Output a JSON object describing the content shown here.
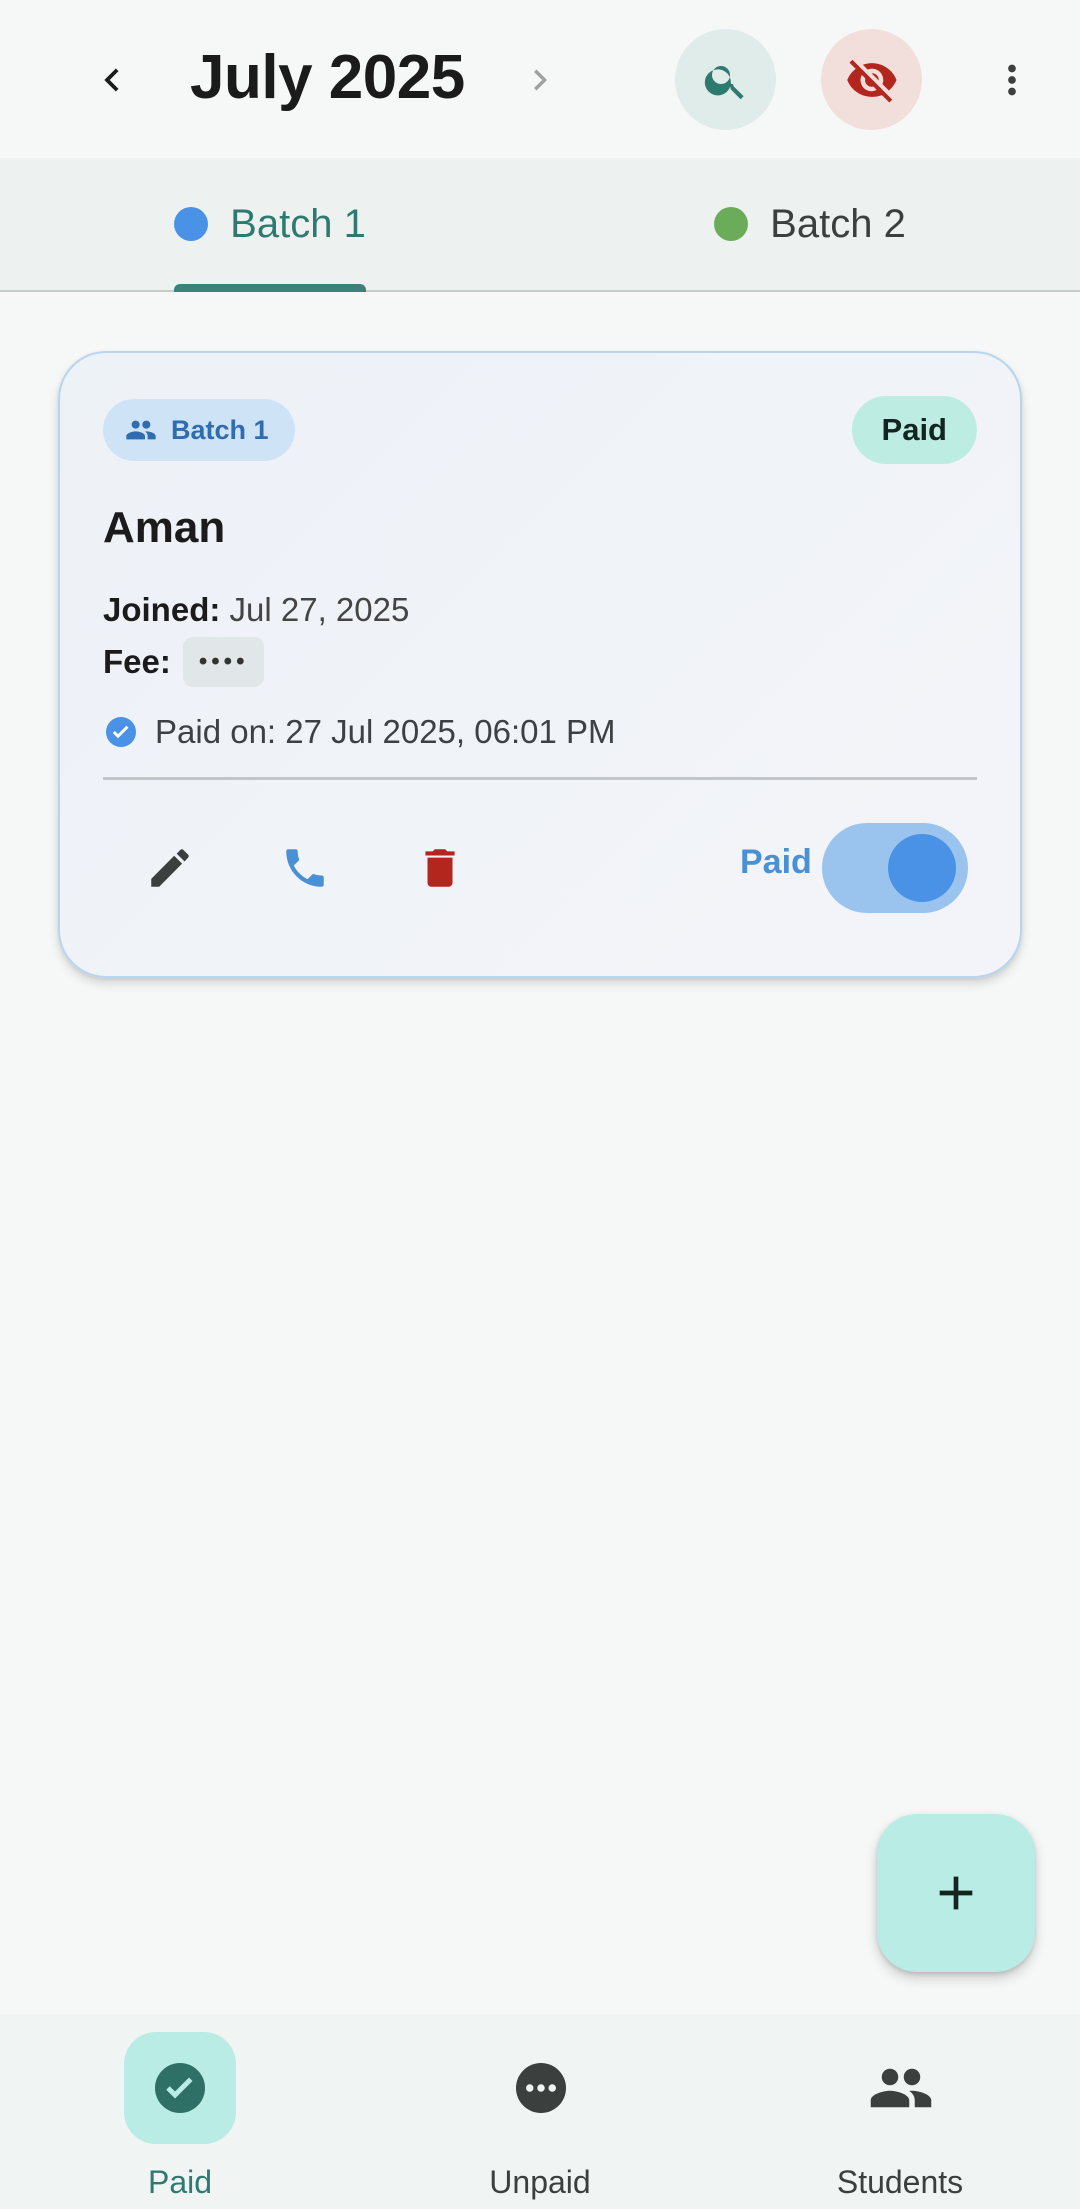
{
  "header": {
    "month_title": "July 2025",
    "icons": [
      "chevron-left-icon",
      "chevron-right-icon",
      "search-icon",
      "visibility-off-icon",
      "more-vert-icon"
    ]
  },
  "tabs": [
    {
      "label": "Batch 1",
      "dot_color": "#4a92e6",
      "selected": true
    },
    {
      "label": "Batch 2",
      "dot_color": "#6aac5a",
      "selected": false
    }
  ],
  "card": {
    "batch_chip": "Batch 1",
    "status": "Paid",
    "name": "Aman",
    "joined_label": "Joined:",
    "joined_value": "Jul 27, 2025",
    "fee_label": "Fee:",
    "fee_value": "••••",
    "paid_on": "Paid on: 27 Jul 2025, 06:01 PM",
    "toggle_label": "Paid",
    "toggle_on": true,
    "actions": [
      "edit-icon",
      "phone-icon",
      "delete-icon"
    ]
  },
  "fab": {
    "icon": "add-icon"
  },
  "bottom_nav": [
    {
      "label": "Paid",
      "icon": "check-circle-icon",
      "active": true
    },
    {
      "label": "Unpaid",
      "icon": "more-horiz-circle-icon",
      "active": false
    },
    {
      "label": "Students",
      "icon": "people-icon",
      "active": false
    }
  ],
  "colors": {
    "accent": "#2e7a70",
    "paid_blue": "#4a92e6",
    "delete_red": "#b3261e",
    "chip_bg": "#cfe3f7",
    "badge_bg": "#bdece3"
  }
}
